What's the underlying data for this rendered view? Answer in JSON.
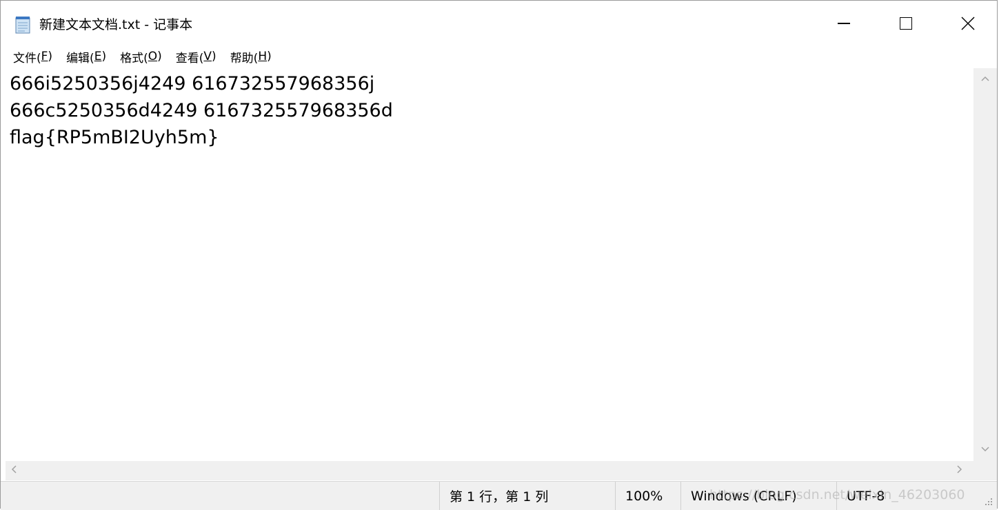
{
  "window": {
    "title": "新建文本文档.txt - 记事本",
    "icon": "notepad-icon",
    "controls": {
      "minimize": "minimize-icon",
      "maximize": "maximize-icon",
      "close": "close-icon"
    }
  },
  "menu": [
    {
      "text": "文件(",
      "key": "F",
      "end": ")"
    },
    {
      "text": "编辑(",
      "key": "E",
      "end": ")"
    },
    {
      "text": "格式(",
      "key": "O",
      "end": ")"
    },
    {
      "text": "查看(",
      "key": "V",
      "end": ")"
    },
    {
      "text": "帮助(",
      "key": "H",
      "end": ")"
    }
  ],
  "editor": {
    "lines": [
      "666i5250356j4249 616732557968356j",
      "666c5250356d4249 616732557968356d",
      "flag{RP5mBI2Uyh5m}"
    ]
  },
  "statusbar": {
    "position": "第 1 行，第 1 列",
    "zoom": "100%",
    "line_ending": "Windows (CRLF)",
    "encoding": "UTF-8",
    "watermark": "https://blog.csdn.net/weixin_46203060"
  },
  "colors": {
    "scrollbar_bg": "#f0f0f0",
    "statusbar_bg": "#f0f0f0",
    "arrow": "#a0a0a0"
  }
}
